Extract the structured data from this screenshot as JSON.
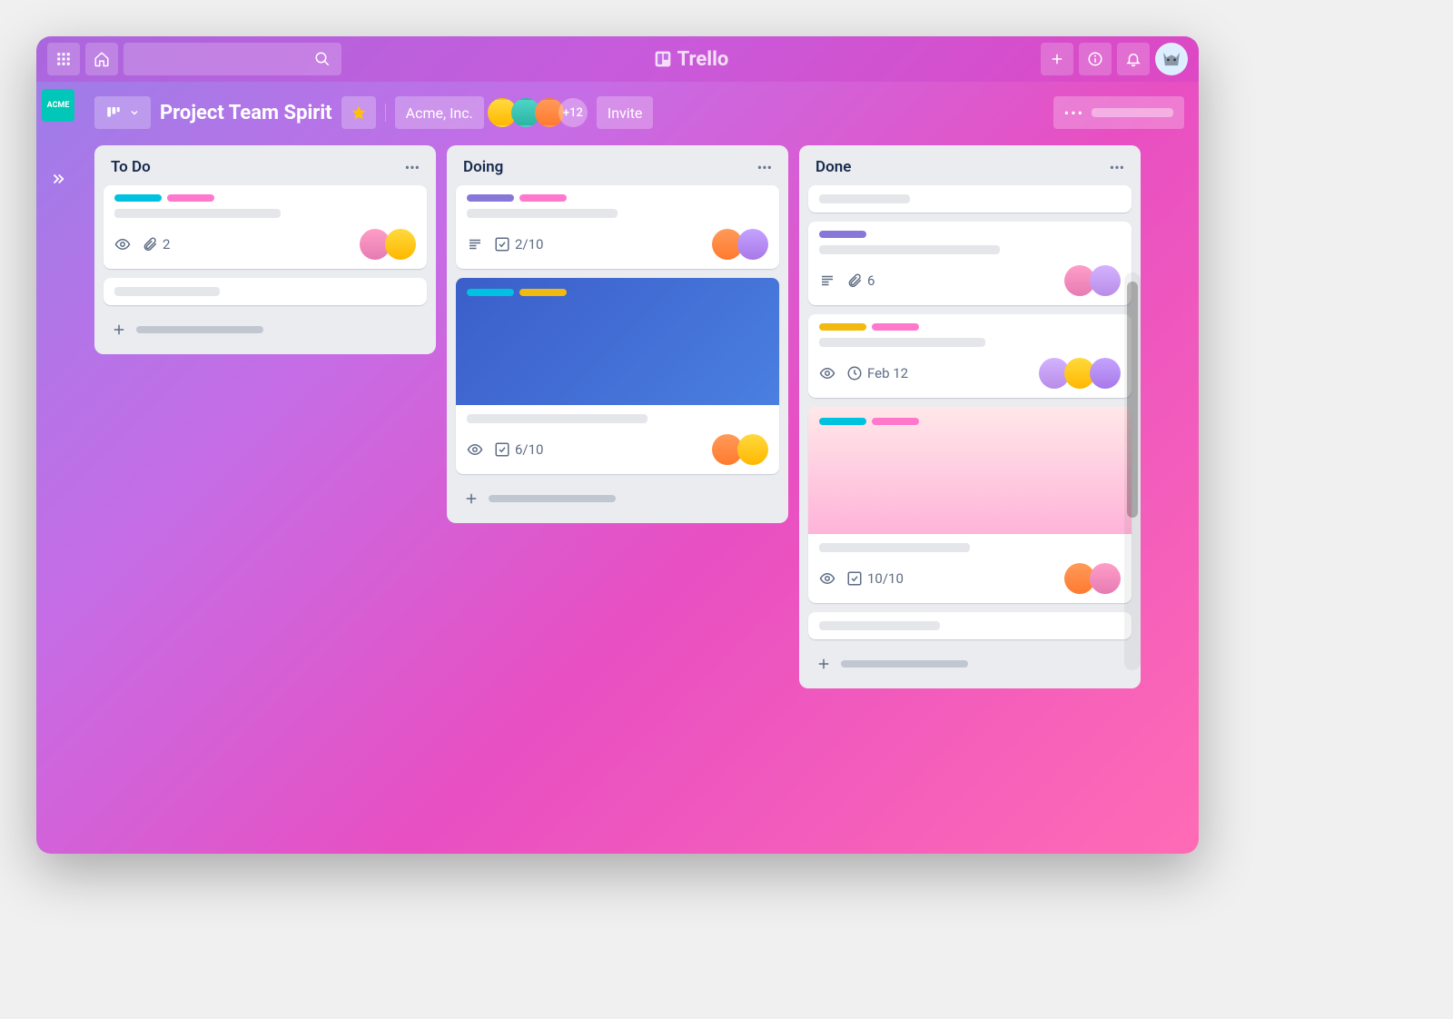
{
  "brand": "Trello",
  "board": {
    "title": "Project Team Spirit",
    "workspace": "Acme, Inc.",
    "workspace_tile": "ACME",
    "extra_members": "+12",
    "invite_label": "Invite"
  },
  "lists": [
    {
      "title": "To Do",
      "cards": [
        {
          "labels": [
            "#00c2e0",
            "#ff78cb"
          ],
          "attachments": "2",
          "has_watch": true,
          "has_attach": true,
          "avatars": [
            "pink",
            "yellow"
          ]
        },
        {
          "placeholder": true
        }
      ]
    },
    {
      "title": "Doing",
      "cards": [
        {
          "labels": [
            "#8777d9",
            "#ff78cb"
          ],
          "checklist": "2/10",
          "has_desc": true,
          "has_check": true,
          "avatars": [
            "orange",
            "purple"
          ]
        },
        {
          "cover": "blue",
          "cover_labels": [
            "#00c2e0",
            "#f2b90f"
          ],
          "checklist": "6/10",
          "has_watch": true,
          "has_check": true,
          "avatars": [
            "orange",
            "yellow"
          ]
        }
      ]
    },
    {
      "title": "Done",
      "cards": [
        {
          "placeholder": true
        },
        {
          "labels": [
            "#8777d9"
          ],
          "attachments": "6",
          "has_desc": true,
          "has_attach": true,
          "avatars": [
            "pink",
            "lav"
          ]
        },
        {
          "labels": [
            "#f2b90f",
            "#ff78cb"
          ],
          "date": "Feb 12",
          "has_watch": true,
          "has_clock": true,
          "avatars": [
            "lav",
            "yellow",
            "purple"
          ]
        },
        {
          "cover": "pink",
          "cover_labels": [
            "#00c2e0",
            "#ff78cb"
          ],
          "checklist": "10/10",
          "has_watch": true,
          "has_check": true,
          "avatars": [
            "orange",
            "pink"
          ]
        },
        {
          "placeholder": true
        }
      ]
    }
  ]
}
